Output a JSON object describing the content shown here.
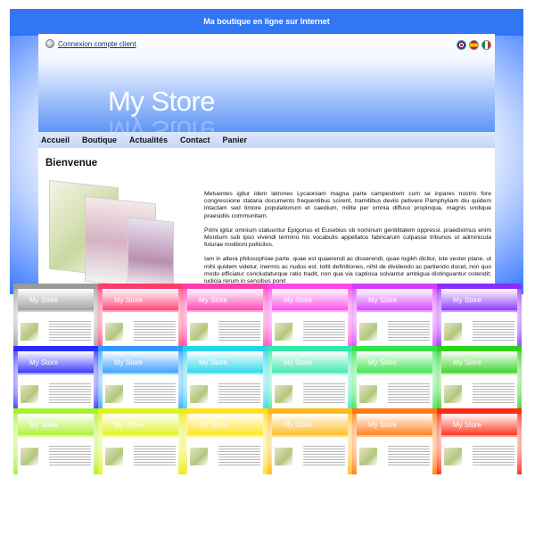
{
  "store": {
    "site_title": "Ma boutique en ligne sur Internet",
    "login_link": "Connexion compte client",
    "logo": "My Store",
    "nav": [
      "Accueil",
      "Boutique",
      "Actualités",
      "Contact",
      "Panier"
    ],
    "heading": "Bienvenue",
    "paragraphs": [
      "Metuentes igitur idem latrones Lycaoniam magna parte campestrem cum se inpares nostris fore congressione stataria documents frequentibus scirent, tramitibus deviis petivere Pamphyliam diu quidem intactam sed timore populationum et caedium, milite per omnia diffuso propinqua, magnis undique praesidiis communitam.",
      "Primi igitur omnium statuuntur Epigonus et Eusebius ob nominum gentilitatem oppressi. praediximus enim Montium sub ipso vivendi termino his vocabulis appellatos fabricarum culpasse tribunos ut adminicula futurae molitioni pollicitos.",
      "Iam in altera philosophiae parte. quae est quaerendi ac disserendi, quae logikh dicitur, iste vester plane, ut mihi quidem videtur, inermis ac nudus est. tollit definitiones, nihil de dividendo ac partiendo docet, non quo modo efficiatur concludaturque ratio tradit, non qua via captiosa solvantur ambigua distinguantur ostendit; iudicia rerum in sensibus ponit"
    ]
  },
  "icons": {
    "login": "user-icon",
    "flags": [
      "uk-flag-icon",
      "spain-flag-icon",
      "italy-flag-icon"
    ]
  },
  "theme_colors": {
    "main": "#3276f4",
    "variants": [
      "#9a9a9a",
      "#ff3b6e",
      "#ff3bb0",
      "#ff45e6",
      "#d53bff",
      "#8b2cff",
      "#2b2bff",
      "#2f9bff",
      "#22d6e8",
      "#35e8a8",
      "#33e34a",
      "#2fd11c",
      "#a8f22d",
      "#dff21a",
      "#ffe21a",
      "#ffb81a",
      "#ff7a12",
      "#ff2a12"
    ]
  }
}
